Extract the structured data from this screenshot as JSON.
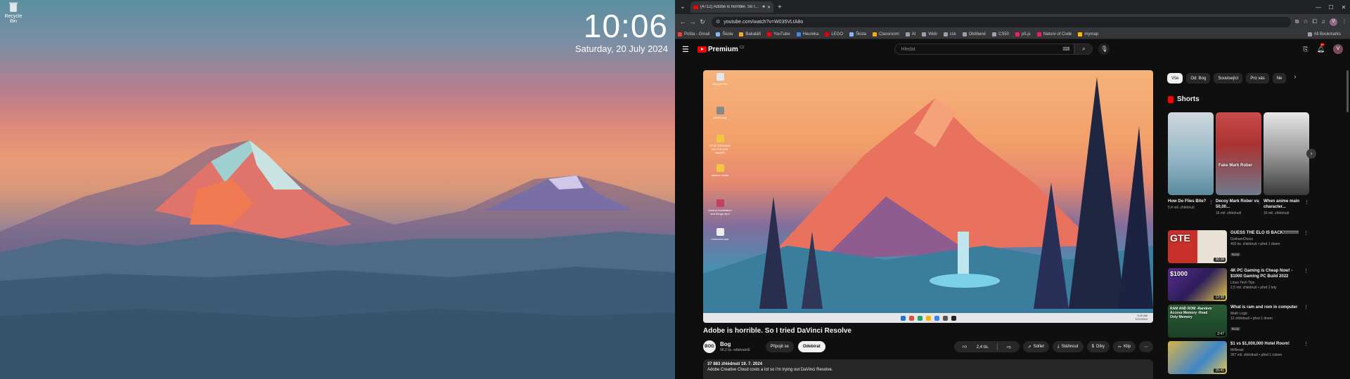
{
  "desktop": {
    "recycle_bin_label": "Recycle Bin",
    "clock_time": "10:06",
    "clock_date": "Saturday, 20 July 2024"
  },
  "browser": {
    "tab_title": "(4712) Adobe is horrible. So I...",
    "url": "youtube.com/watch?v=W035VLtA8o",
    "bookmarks": [
      {
        "label": "Pošta - Gmail",
        "color": "#ea4335"
      },
      {
        "label": "Škola",
        "color": "#8ab4f8"
      },
      {
        "label": "Bakaláři",
        "color": "#f9a825"
      },
      {
        "label": "YouTube",
        "color": "#ff0000"
      },
      {
        "label": "Heureka",
        "color": "#4285f4"
      },
      {
        "label": "LEGO",
        "color": "#e3000b"
      },
      {
        "label": "Škola",
        "color": "#8ab4f8"
      },
      {
        "label": "Classroom",
        "color": "#f9ab00"
      },
      {
        "label": "AI",
        "color": "#9aa0a6"
      },
      {
        "label": "Web",
        "color": "#9aa0a6"
      },
      {
        "label": "csk",
        "color": "#9aa0a6"
      },
      {
        "label": "Oblíbené",
        "color": "#9aa0a6"
      },
      {
        "label": "CS50",
        "color": "#9aa0a6"
      },
      {
        "label": "p5.js",
        "color": "#ed225d"
      },
      {
        "label": "Nature of Code",
        "color": "#ed225d"
      },
      {
        "label": "mymap",
        "color": "#fbbc04"
      }
    ],
    "all_bookmarks_label": "All Bookmarks"
  },
  "youtube": {
    "logo_word": "Premium",
    "logo_cc": "CZ",
    "search_placeholder": "Hledat",
    "notification_count": "9+",
    "avatar_letter": "V",
    "video": {
      "title": "Adobe is horrible. So I tried DaVinci Resolve",
      "channel": "Bog",
      "channel_avatar": "BOG",
      "subscribers": "98,2 tis. odběratelů",
      "join_label": "Připojit se",
      "subscribe_label": "Odebírat",
      "likes": "2,4 tis.",
      "share_label": "Sdílet",
      "download_label": "Stáhnout",
      "thanks_label": "Díky",
      "clip_label": "Klip",
      "stats": "37 883 zhlédnutí  19. 7. 2024",
      "description": "Adobe Creative Cloud costs a lot so I'm trying out DaVinci Resolve.",
      "inner_desktop_icons": [
        "Recycle Bin",
        "pixel4.png",
        "STOP READING MY FOLDER NAMES",
        "davinci media",
        "Davinci installation and things.mp4",
        "voiceover.wav"
      ],
      "inner_tray_time": "9:42 AM",
      "inner_tray_date": "7/21/2024"
    },
    "chips": [
      "Vše",
      "Od: Bog",
      "Související",
      "Pro vás",
      "Ne"
    ],
    "shorts_heading": "Shorts",
    "shorts": [
      {
        "title": "How Do Flies Bite?",
        "views": "5,4 mil. zhlédnutí",
        "caption": ""
      },
      {
        "title": "Decoy Mark Rober vs 50,00...",
        "views": "16 mil. zhlédnutí",
        "caption": "Fake Mark Rober"
      },
      {
        "title": "When anime main character...",
        "views": "16 mil. zhlédnutí",
        "caption": ""
      }
    ],
    "recommendations": [
      {
        "title": "GUESS THE ELO IS BACK!!!!!!!!!!!",
        "channel": "GothamChess",
        "meta": "403 tis. zhlédnutí • před 1 dnem",
        "badge": "Nový",
        "duration": "36:38",
        "thumb_text": "GTE"
      },
      {
        "title": "4K PC Gaming is Cheap Now! - $1000 Gaming PC Build 2022",
        "channel": "Linus Tech Tips",
        "meta": "2,5 mil. zhlédnutí • před 2 lety",
        "badge": "",
        "duration": "12:38",
        "thumb_text": "$1000"
      },
      {
        "title": "What is ram and rom in computer",
        "channel": "Math Logic",
        "meta": "12 zhlédnutí • před 1 dnem",
        "badge": "Nový",
        "duration": "2:47",
        "thumb_text": "RAM AND ROM -Random Access Memory -Read Only Memory"
      },
      {
        "title": "$1 vs $1,000,000 Hotel Room!",
        "channel": "MrBeast",
        "meta": "357 mil. zhlédnutí • před 1 rokem",
        "badge": "",
        "duration": "15:41",
        "thumb_text": ""
      }
    ]
  }
}
